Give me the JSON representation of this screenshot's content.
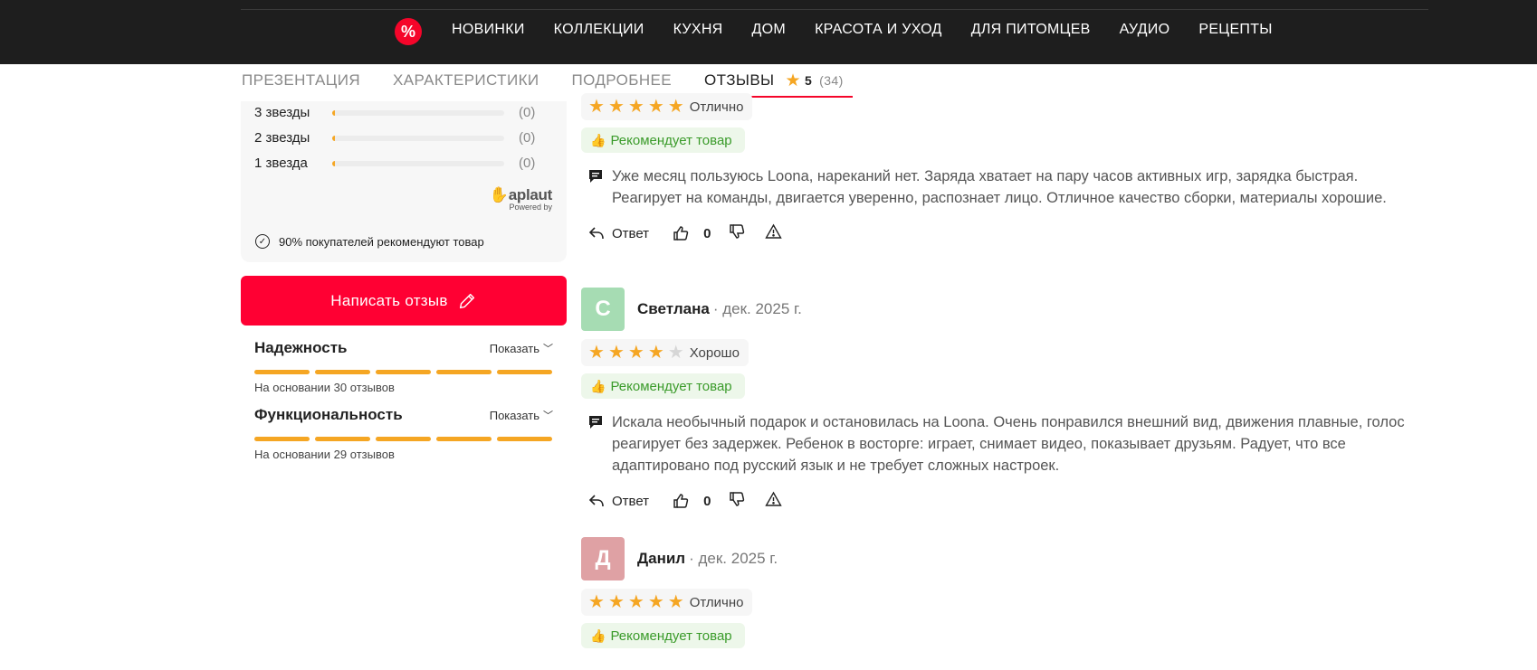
{
  "nav": {
    "badge": "%",
    "items": [
      "НОВИНКИ",
      "КОЛЛЕКЦИИ",
      "КУХНЯ",
      "ДОМ",
      "КРАСОТА И УХОД",
      "ДЛЯ ПИТОМЦЕВ",
      "АУДИО",
      "РЕЦЕПТЫ"
    ]
  },
  "tabs": {
    "items": [
      "ПРЕЗЕНТАЦИЯ",
      "ХАРАКТЕРИСТИКИ",
      "ПОДРОБНЕЕ"
    ],
    "active": "ОТЗЫВЫ",
    "score": "5",
    "count": "(34)"
  },
  "summary": {
    "rows": [
      {
        "label": "3 звезды",
        "count": "(0)",
        "fraction": 0.0
      },
      {
        "label": "2 звезды",
        "count": "(0)",
        "fraction": 0.0
      },
      {
        "label": "1 звезда",
        "count": "(0)",
        "fraction": 0.0
      }
    ],
    "brand": "aplaut",
    "powered": "Powered by",
    "recommend_text": "90% покупателей рекомендуют товар"
  },
  "write_review_label": "Написать отзыв",
  "params": [
    {
      "title": "Надежность",
      "show_label": "Показать",
      "basis": "На основании 30 отзывов",
      "level": 5
    },
    {
      "title": "Функциональность",
      "show_label": "Показать",
      "basis": "На основании 29 отзывов",
      "level": 5
    }
  ],
  "reviews": [
    {
      "rating": 5,
      "verdict": "Отлично",
      "recommend": "Рекомендует товар",
      "text": "Уже месяц пользуюсь Loona, нареканий нет. Заряда хватает на пару часов активных игр, зарядка быстрая. Реагирует на команды, двигается уверенно, распознает лицо. Отличное качество сборки, материалы хорошие.",
      "reply_label": "Ответ",
      "votes": "0"
    },
    {
      "avatar_letter": "С",
      "avatar_color": "#a6dcb3",
      "name": "Светлана",
      "date": "· дек. 2025 г.",
      "rating": 4,
      "verdict": "Хорошо",
      "recommend": "Рекомендует товар",
      "text": "Искала необычный подарок и остановилась на Loona. Очень понравился внешний вид, движения плавные, голос реагирует без задержек. Ребенок в восторге: играет, снимает видео, показывает друзьям. Радует, что все адаптировано под русский язык и не требует сложных настроек.",
      "reply_label": "Ответ",
      "votes": "0"
    },
    {
      "avatar_letter": "Д",
      "avatar_color": "#dfa1a4",
      "name": "Данил",
      "date": "· дек. 2025 г.",
      "rating": 5,
      "verdict": "Отлично",
      "recommend": "Рекомендует товар"
    }
  ],
  "colors": {
    "accent": "#ff0033",
    "star": "#f5a623",
    "recommend_green": "#3a9b2a",
    "nav_bg": "#1e1e1e"
  }
}
